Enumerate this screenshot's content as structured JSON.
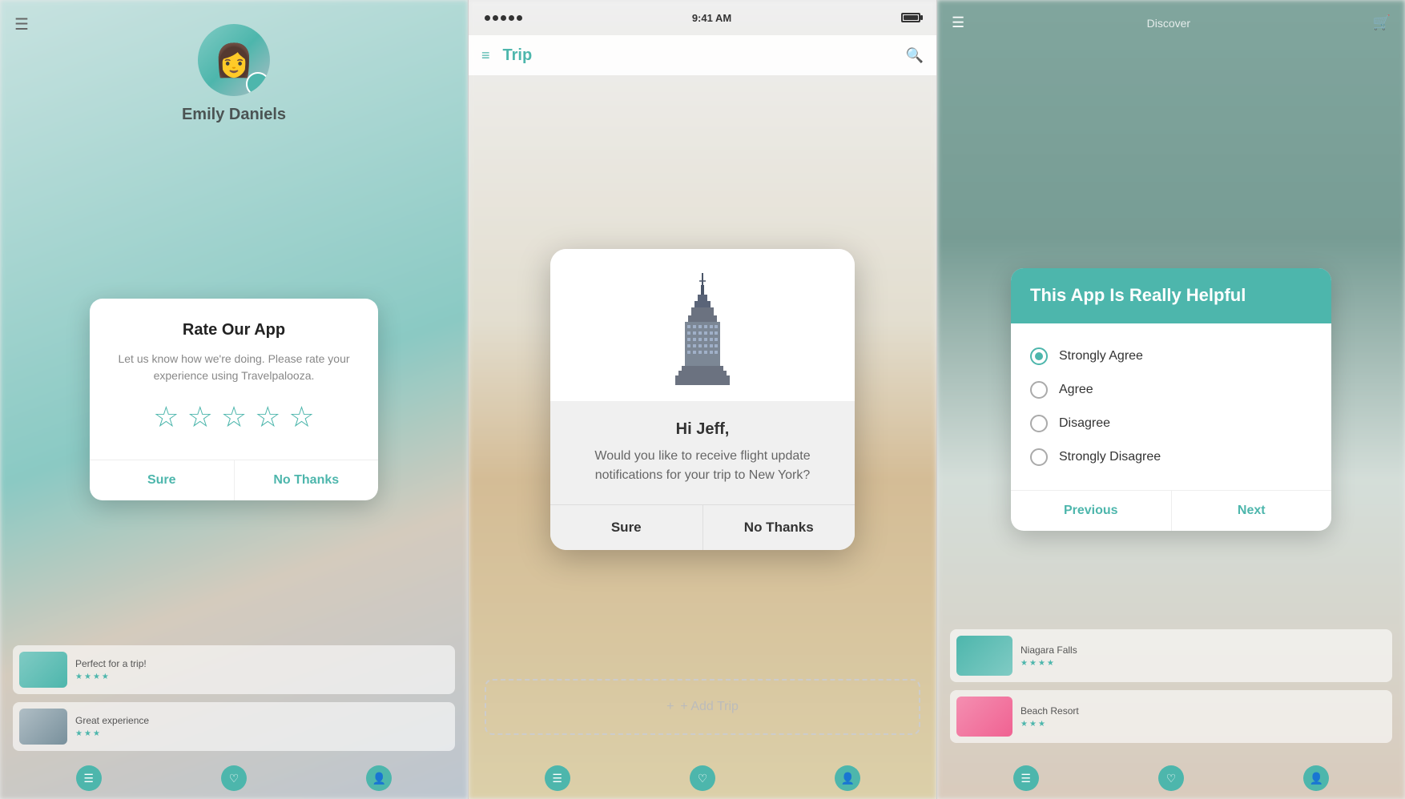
{
  "panels": {
    "left": {
      "hamburger": "☰",
      "profile_name": "Emily Daniels",
      "modal": {
        "title": "Rate Our App",
        "description": "Let us know how we're doing. Please rate your experience using Travelpalooza.",
        "stars_count": 5,
        "btn_sure": "Sure",
        "btn_no_thanks": "No Thanks"
      },
      "cards": [
        {
          "title": "Perfect for a trip!"
        },
        {
          "title": "Great experience"
        }
      ],
      "bottom_nav": [
        "☰",
        "♡",
        "👤"
      ]
    },
    "center": {
      "status_bar": {
        "dots": 5,
        "time": "9:41 AM"
      },
      "header_title": "Trip",
      "modal": {
        "greeting": "Hi Jeff,",
        "description": "Would you like to receive flight update notifications for your trip to New York?",
        "btn_sure": "Sure",
        "btn_no_thanks": "No Thanks"
      },
      "add_trip_label": "+ Add Trip"
    },
    "right": {
      "modal": {
        "title": "This App Is Really Helpful",
        "options": [
          {
            "label": "Strongly Agree",
            "selected": true
          },
          {
            "label": "Agree",
            "selected": false
          },
          {
            "label": "Disagree",
            "selected": false
          },
          {
            "label": "Strongly Disagree",
            "selected": false
          }
        ],
        "btn_previous": "Previous",
        "btn_next": "Next"
      },
      "cards": [
        {
          "title": "Niagara Falls"
        },
        {
          "title": "Beach Resort"
        }
      ],
      "bottom_nav": [
        "☰",
        "♡",
        "👤"
      ]
    }
  }
}
